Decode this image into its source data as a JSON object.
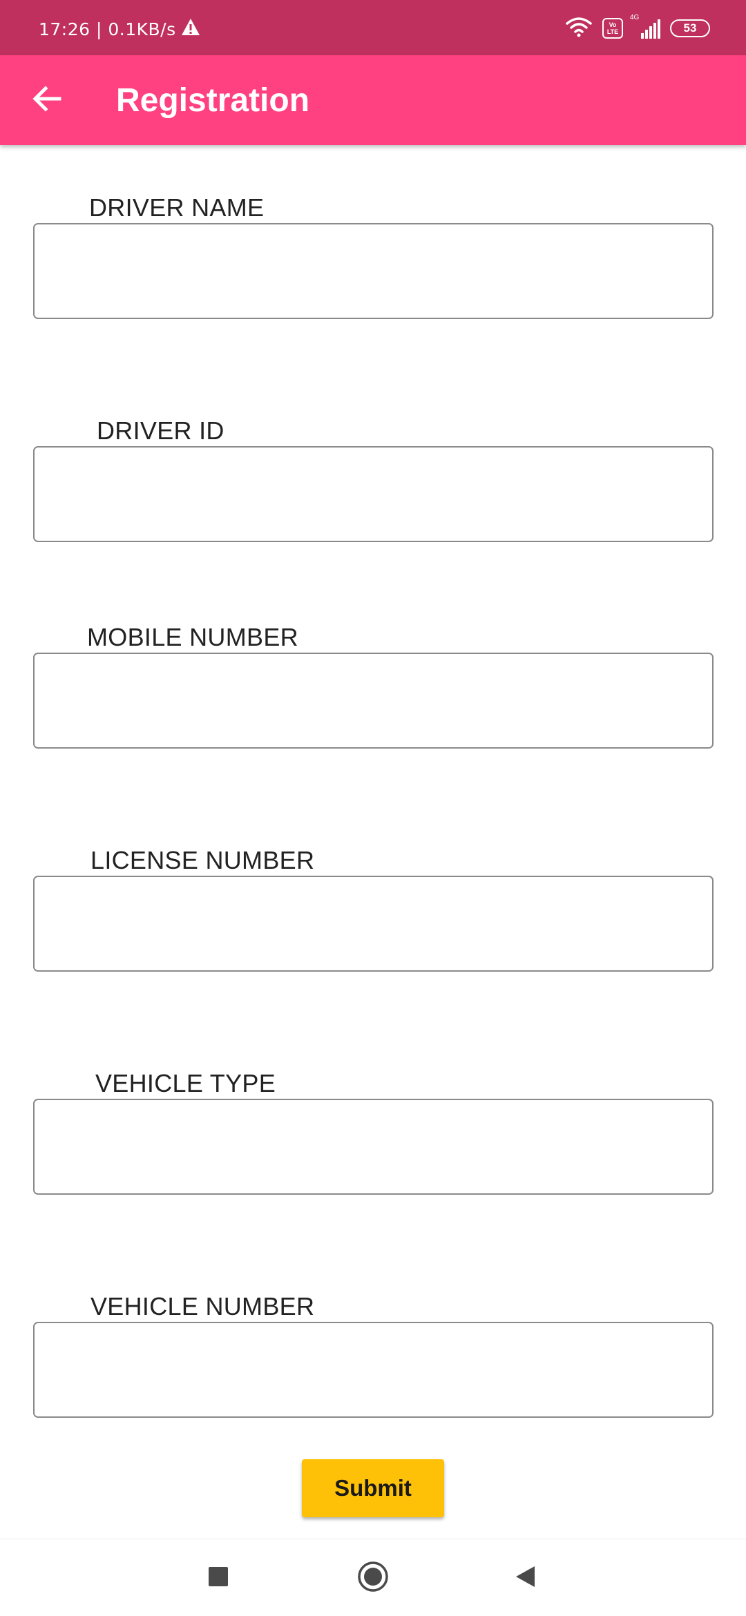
{
  "status_bar": {
    "time_speed": "17:26 | 0.1KB/s",
    "volte_top": "Vo",
    "volte_bottom": "LTE",
    "network": "4G",
    "battery": "53"
  },
  "app_bar": {
    "title": "Registration"
  },
  "form": {
    "fields": [
      {
        "label": "DRIVER NAME",
        "value": "",
        "placeholder": ""
      },
      {
        "label": "DRIVER ID",
        "value": "",
        "placeholder": ""
      },
      {
        "label": "MOBILE NUMBER",
        "value": "",
        "placeholder": ""
      },
      {
        "label": "LICENSE NUMBER",
        "value": "",
        "placeholder": ""
      },
      {
        "label": "VEHICLE TYPE",
        "value": "",
        "placeholder": ""
      },
      {
        "label": "VEHICLE NUMBER",
        "value": "",
        "placeholder": ""
      }
    ],
    "submit_label": "Submit"
  },
  "colors": {
    "status_bar": "#c0305e",
    "app_bar": "#ff4081",
    "submit_button": "#ffc107"
  },
  "icons": {
    "back": "arrow-left-icon",
    "wifi": "wifi-icon",
    "signal": "signal-icon",
    "warning": "warning-icon",
    "nav_recents": "square-icon",
    "nav_home": "circle-icon",
    "nav_back": "triangle-back-icon"
  }
}
